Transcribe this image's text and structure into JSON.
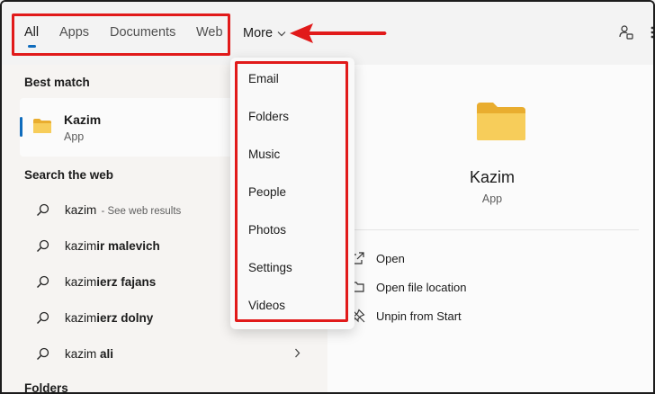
{
  "tabs": [
    {
      "label": "All",
      "active": true
    },
    {
      "label": "Apps"
    },
    {
      "label": "Documents"
    },
    {
      "label": "Web"
    }
  ],
  "more": {
    "label": "More"
  },
  "sections": {
    "best_match": "Best match",
    "search_web": "Search the web",
    "folders": "Folders"
  },
  "best_match": {
    "title": "Kazim",
    "subtitle": "App",
    "icon": "folder-icon"
  },
  "web_results": [
    {
      "prefix": "kazim",
      "suffix": "",
      "hint": " - See web results"
    },
    {
      "prefix": "kazim",
      "suffix": "ir malevich",
      "hint": ""
    },
    {
      "prefix": "kazim",
      "suffix": "ierz fajans",
      "hint": ""
    },
    {
      "prefix": "kazim",
      "suffix": "ierz dolny",
      "hint": ""
    },
    {
      "prefix": "kazim",
      "suffix": " ali",
      "hint": ""
    }
  ],
  "preview": {
    "title": "Kazim",
    "subtitle": "App",
    "actions": [
      {
        "label": "Open",
        "icon": "open-icon"
      },
      {
        "label": "Open file location",
        "icon": "folder-open-icon"
      },
      {
        "label": "Unpin from Start",
        "icon": "unpin-icon"
      }
    ]
  },
  "more_menu": [
    "Email",
    "Folders",
    "Music",
    "People",
    "Photos",
    "Settings",
    "Videos"
  ],
  "colors": {
    "annotation": "#e11a1a",
    "accent": "#0f6cbd",
    "folder": "#f5c542"
  }
}
